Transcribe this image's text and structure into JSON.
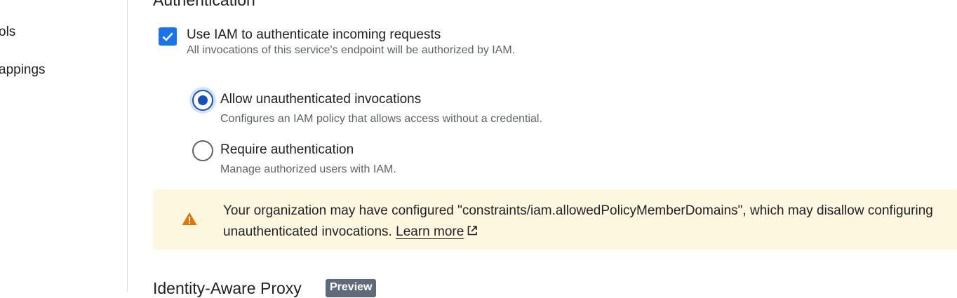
{
  "sidebar": {
    "items": [
      {
        "label": "ols"
      },
      {
        "label": "appings"
      }
    ]
  },
  "authentication": {
    "title": "Authentication",
    "iam_checkbox": {
      "checked": true,
      "label": "Use IAM to authenticate incoming requests",
      "description": "All invocations of this service's endpoint will be authorized by IAM."
    },
    "options": [
      {
        "label": "Allow unauthenticated invocations",
        "description": "Configures an IAM policy that allows access without a credential.",
        "selected": true
      },
      {
        "label": "Require authentication",
        "description": "Manage authorized users with IAM.",
        "selected": false
      }
    ]
  },
  "warning": {
    "icon": "warning-triangle-icon",
    "text": "Your organization may have configured \"constraints/iam.allowedPolicyMemberDomains\", which may disallow configuring unauthenticated invocations.",
    "link_label": "Learn more",
    "link_icon": "external-link-icon"
  },
  "iap": {
    "title": "Identity-Aware Proxy",
    "badge": "Preview"
  },
  "colors": {
    "accent": "#1a73e8",
    "radio_selected": "#1a4fb8",
    "warning_bg": "#fef7e0",
    "warning_icon": "#e37400",
    "badge_bg": "#5f6b7a"
  }
}
